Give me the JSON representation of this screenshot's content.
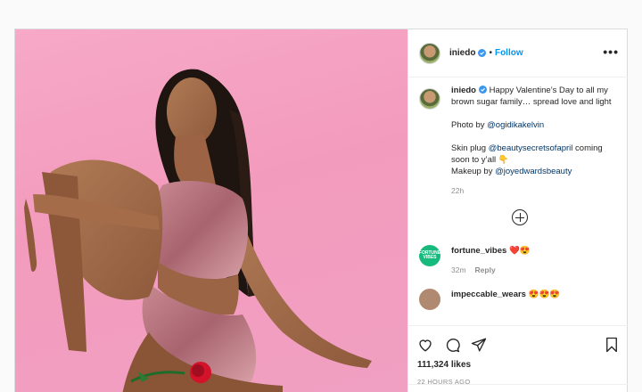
{
  "post": {
    "username": "iniedo",
    "follow_label": "Follow",
    "separator": "•",
    "more_label": "•••",
    "caption": {
      "line1": "Happy Valentine’s Day to all my brown sugar family… spread love and light",
      "photo_prefix": "Photo by ",
      "photo_handle": "@ogidikakelvin",
      "skin_prefix": "Skin plug ",
      "skin_handle": "@beautysecretsofapril",
      "skin_suffix": " coming soon to y’all 👇",
      "makeup_prefix": "Makeup by ",
      "makeup_handle": "@joyedwardsbeauty",
      "time": "22h"
    },
    "comments": [
      {
        "username": "fortune_vibes",
        "text": "❤️😍",
        "time": "32m",
        "reply_label": "Reply",
        "avatar_text": "FORTUNE VIBES"
      },
      {
        "username": "impeccable_wears",
        "text": "😍😍😍"
      }
    ],
    "likes": "111,324 likes",
    "posted_ago": "22 HOURS AGO"
  },
  "colors": {
    "accent": "#0095f6",
    "link": "#00376b",
    "background": "#fafafa",
    "photo_bg": "#f4a3c4"
  },
  "icons": [
    "verified-icon",
    "more-options-icon",
    "load-more-comments-icon",
    "heart-icon",
    "comment-icon",
    "share-icon",
    "bookmark-icon"
  ]
}
